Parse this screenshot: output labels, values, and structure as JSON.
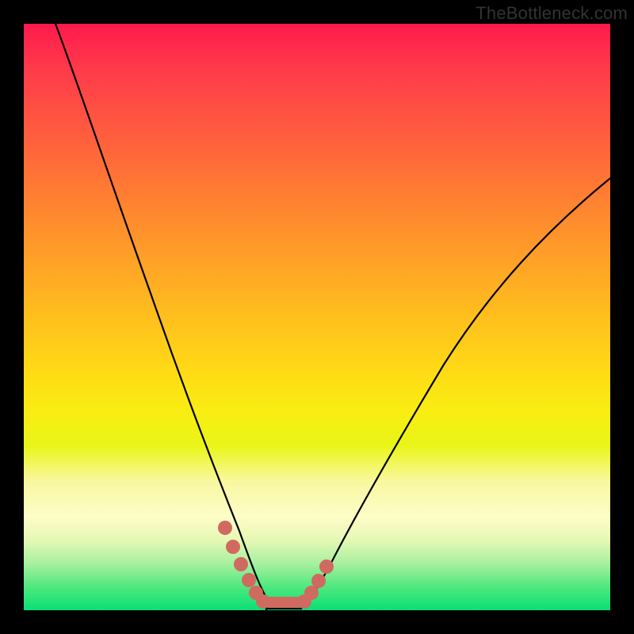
{
  "watermark": "TheBottleneck.com",
  "colors": {
    "background": "#000000",
    "curve": "#000000",
    "marker": "#d06a60",
    "gradient_top": "#ff1a4d",
    "gradient_bottom": "#09df74"
  },
  "chart_data": {
    "type": "line",
    "title": "",
    "xlabel": "",
    "ylabel": "",
    "xlim": [
      0,
      100
    ],
    "ylim": [
      0,
      100
    ],
    "grid": false,
    "legend": false,
    "annotations": [
      {
        "text": "TheBottleneck.com",
        "position": "top-right"
      }
    ],
    "series": [
      {
        "name": "left-branch",
        "x": [
          0,
          5,
          10,
          15,
          20,
          25,
          30,
          35,
          37,
          39,
          41
        ],
        "values": [
          100,
          86,
          72,
          58,
          45,
          33,
          22,
          12,
          7,
          3,
          1
        ]
      },
      {
        "name": "right-branch",
        "x": [
          47,
          49,
          52,
          56,
          62,
          70,
          80,
          90,
          100
        ],
        "values": [
          1,
          3,
          6,
          12,
          22,
          36,
          52,
          64,
          74
        ]
      },
      {
        "name": "valley-floor",
        "x": [
          41,
          47
        ],
        "values": [
          0,
          0
        ]
      }
    ],
    "markers": {
      "name": "highlighted-points",
      "x": [
        34,
        35.5,
        37,
        38.5,
        40,
        41.5,
        43,
        44.5,
        46,
        47.5,
        49,
        50.5,
        52
      ],
      "values": [
        14,
        11,
        8,
        5,
        3,
        1.5,
        1,
        1,
        1,
        1.5,
        3,
        5,
        8
      ]
    }
  }
}
